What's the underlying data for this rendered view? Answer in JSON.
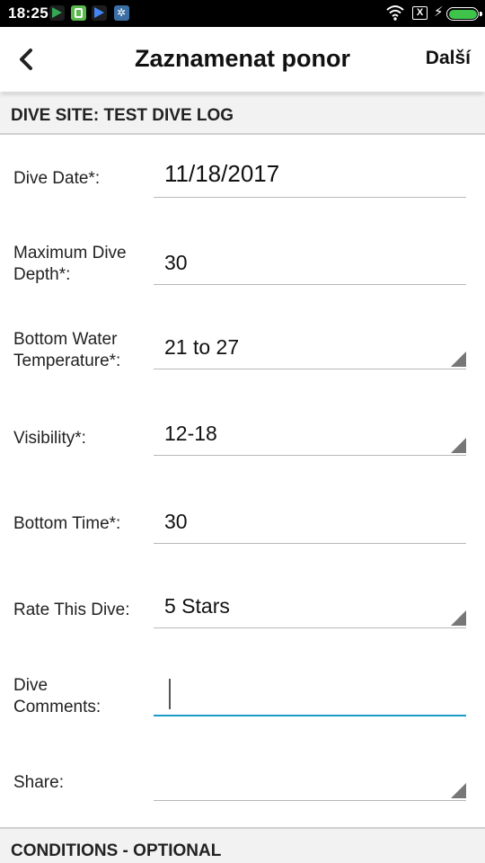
{
  "status_bar": {
    "time": "18:25",
    "sim_badge": "X"
  },
  "app_bar": {
    "back_icon": "back-arrow-icon",
    "title": "Zaznamenat ponor",
    "next_label": "Další"
  },
  "dive_site": {
    "header": "DIVE SITE: TEST DIVE LOG"
  },
  "form": {
    "dive_date": {
      "label": "Dive Date*:",
      "value": "11/18/2017"
    },
    "max_depth": {
      "label": "Maximum Dive Depth*:",
      "value": "30"
    },
    "bottom_temp": {
      "label": "Bottom Water Temperature*:",
      "value": "21 to 27"
    },
    "visibility": {
      "label": "Visibility*:",
      "value": "12-18"
    },
    "bottom_time": {
      "label": "Bottom Time*:",
      "value": "30"
    },
    "rating": {
      "label": "Rate This Dive:",
      "value": "5 Stars"
    },
    "comments": {
      "label": "Dive Comments:",
      "value": ""
    },
    "share": {
      "label": "Share:",
      "value": ""
    }
  },
  "conditions": {
    "header": "CONDITIONS - OPTIONAL"
  },
  "colors": {
    "active_underline": "#1a9bc7",
    "battery": "#3ec44b"
  }
}
